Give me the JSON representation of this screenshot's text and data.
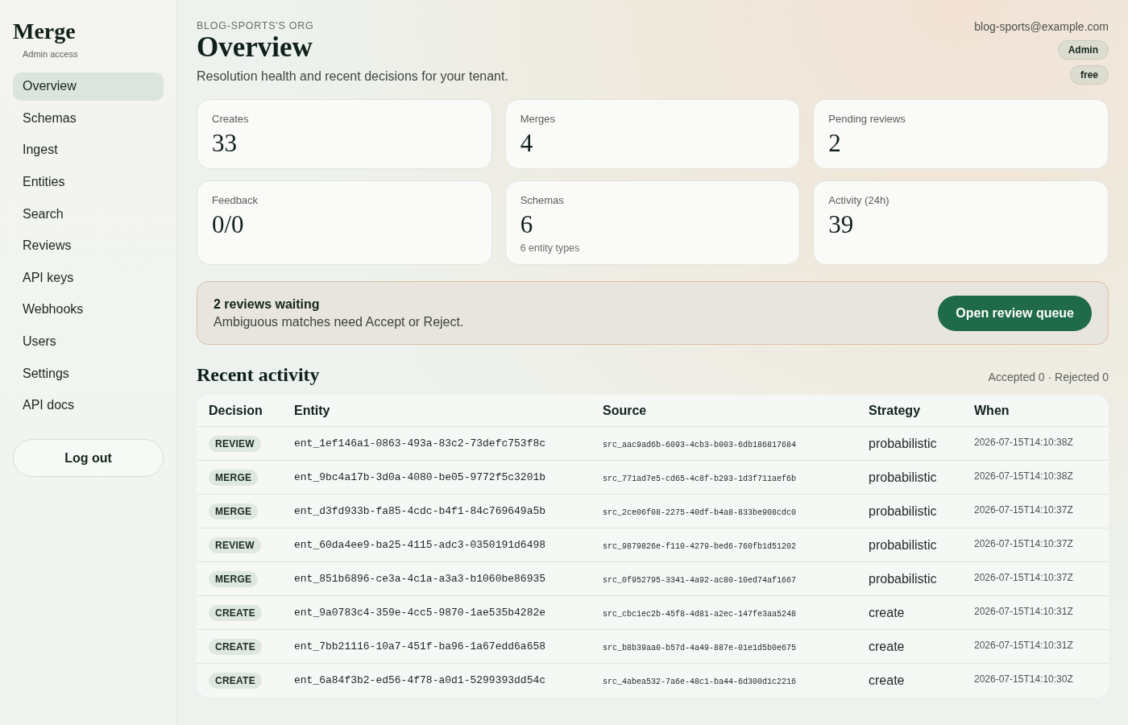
{
  "sidebar": {
    "brand": "Merge",
    "subtitle": "Admin access",
    "items": [
      {
        "label": "Overview",
        "selected": true
      },
      {
        "label": "Schemas",
        "selected": false
      },
      {
        "label": "Ingest",
        "selected": false
      },
      {
        "label": "Entities",
        "selected": false
      },
      {
        "label": "Search",
        "selected": false
      },
      {
        "label": "Reviews",
        "selected": false
      },
      {
        "label": "API keys",
        "selected": false
      },
      {
        "label": "Webhooks",
        "selected": false
      },
      {
        "label": "Users",
        "selected": false
      },
      {
        "label": "Settings",
        "selected": false
      },
      {
        "label": "API docs",
        "selected": false
      }
    ],
    "logout": "Log out"
  },
  "header": {
    "org": "BLOG-SPORTS'S ORG",
    "title": "Overview",
    "description": "Resolution health and recent decisions for your tenant.",
    "email": "blog-sports@example.com",
    "tags": [
      "Admin",
      "free"
    ]
  },
  "stats": [
    {
      "label": "Creates",
      "value": "33"
    },
    {
      "label": "Merges",
      "value": "4"
    },
    {
      "label": "Pending reviews",
      "value": "2"
    },
    {
      "label": "Feedback",
      "value": "0/0"
    },
    {
      "label": "Schemas",
      "value": "6",
      "note": "6 entity types"
    },
    {
      "label": "Activity (24h)",
      "value": "39"
    }
  ],
  "banner": {
    "title": "2 reviews waiting",
    "message": "Ambiguous matches need Accept or Reject.",
    "button": "Open review queue"
  },
  "activity": {
    "title": "Recent activity",
    "summary": "Accepted 0 · Rejected 0",
    "columns": [
      "Decision",
      "Entity",
      "Source",
      "Strategy",
      "When"
    ],
    "rows": [
      {
        "decision": "REVIEW",
        "entity": "ent_1ef146a1-0863-493a-83c2-73defc753f8c",
        "source": "src_aac9ad6b-6093-4cb3-b003-6db186817684",
        "strategy": "probabilistic",
        "when": "2026-07-15T14:10:38Z"
      },
      {
        "decision": "MERGE",
        "entity": "ent_9bc4a17b-3d0a-4080-be05-9772f5c3201b",
        "source": "src_771ad7e5-cd65-4c8f-b293-1d3f711aef6b",
        "strategy": "probabilistic",
        "when": "2026-07-15T14:10:38Z"
      },
      {
        "decision": "MERGE",
        "entity": "ent_d3fd933b-fa85-4cdc-b4f1-84c769649a5b",
        "source": "src_2ce06f08-2275-40df-b4a8-833be908cdc0",
        "strategy": "probabilistic",
        "when": "2026-07-15T14:10:37Z"
      },
      {
        "decision": "REVIEW",
        "entity": "ent_60da4ee9-ba25-4115-adc3-0350191d6498",
        "source": "src_9879826e-f110-4279-bed6-760fb1d51202",
        "strategy": "probabilistic",
        "when": "2026-07-15T14:10:37Z"
      },
      {
        "decision": "MERGE",
        "entity": "ent_851b6896-ce3a-4c1a-a3a3-b1060be86935",
        "source": "src_0f952795-3341-4a92-ac80-10ed74af1667",
        "strategy": "probabilistic",
        "when": "2026-07-15T14:10:37Z"
      },
      {
        "decision": "CREATE",
        "entity": "ent_9a0783c4-359e-4cc5-9870-1ae535b4282e",
        "source": "src_cbc1ec2b-45f8-4d81-a2ec-147fe3aa5248",
        "strategy": "create",
        "when": "2026-07-15T14:10:31Z"
      },
      {
        "decision": "CREATE",
        "entity": "ent_7bb21116-10a7-451f-ba96-1a67edd6a658",
        "source": "src_b8b39aa0-b57d-4a49-887e-01e1d5b0e675",
        "strategy": "create",
        "when": "2026-07-15T14:10:31Z"
      },
      {
        "decision": "CREATE",
        "entity": "ent_6a84f3b2-ed56-4f78-a0d1-5299393dd54c",
        "source": "src_4abea532-7a6e-48c1-ba44-6d300d1c2216",
        "strategy": "create",
        "when": "2026-07-15T14:10:30Z"
      }
    ]
  }
}
